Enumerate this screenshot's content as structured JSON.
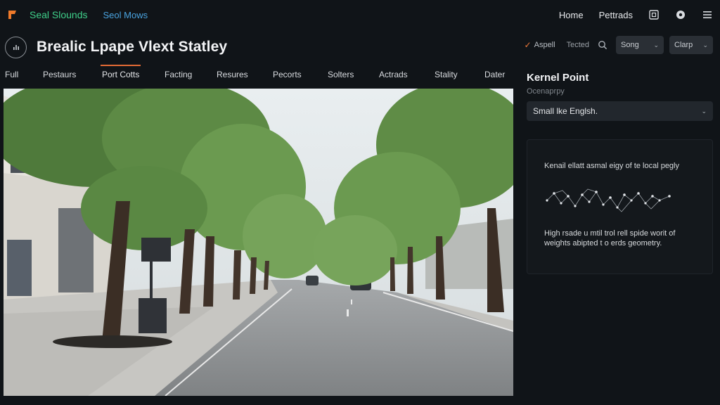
{
  "header": {
    "brand_name": "Seal Slounds",
    "brand_sub": "Seol Mows",
    "nav": [
      "Home",
      "Pettrads"
    ],
    "icons": [
      "window-icon",
      "settings-icon",
      "menu-icon"
    ],
    "brand_color": "#3fd08a",
    "sub_color": "#4aa3df",
    "logo_color": "#f07a2a"
  },
  "title": {
    "text": "Brealic Lpape Vlext Statley"
  },
  "tools": {
    "check_label": "Aspell",
    "text_label": "Tected",
    "select_a": "Song",
    "select_b": "Clarp"
  },
  "tabs": {
    "items": [
      "Full",
      "Pestaurs",
      "Port Cotts",
      "Facting",
      "Resures",
      "Pecorts",
      "Solters",
      "Actrads",
      "Stality",
      "Dater"
    ],
    "active_index": 2,
    "accent": "#e46a35"
  },
  "panel": {
    "title": "Kernel Point",
    "subtitle": "Ocenaprpy",
    "language": "Small lke Englsh.",
    "card_top": "Kenail ellatt asmal eigy of te local pegly",
    "card_bottom": "High rsade u mtil trol rell spide worit of weights abipted t o erds geometry."
  }
}
